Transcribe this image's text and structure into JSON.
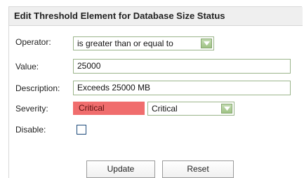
{
  "header": {
    "title": "Edit Threshold Element for Database Size Status"
  },
  "form": {
    "operator": {
      "label": "Operator:",
      "value": "is greater than or equal to"
    },
    "value": {
      "label": "Value:",
      "value": "25000"
    },
    "description": {
      "label": "Description:",
      "value": "Exceeds 25000 MB"
    },
    "severity": {
      "label": "Severity:",
      "swatch_text": "Critical",
      "swatch_color": "#f06d6d",
      "value": "Critical"
    },
    "disable": {
      "label": "Disable:",
      "checked": false
    }
  },
  "buttons": {
    "update": "Update",
    "reset": "Reset"
  },
  "colors": {
    "field_border": "#9bb58b",
    "dropdown_button": "#a9c890",
    "header_bg": "#efefef"
  },
  "icons": {
    "dropdown": "chevron-down-icon"
  }
}
